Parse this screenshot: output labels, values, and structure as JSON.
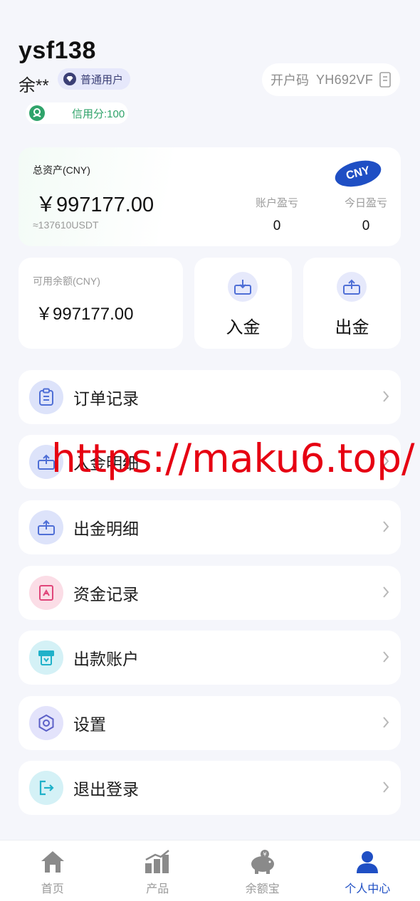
{
  "profile": {
    "username": "ysf138",
    "real_name": "余**",
    "user_level": "普通用户",
    "credit_score": "信用分:100",
    "invite_label": "开户码",
    "invite_code": "YH692VF"
  },
  "assets": {
    "total_label": "总资产(CNY)",
    "total_amount": "￥997177.00",
    "usdt_equiv": "≈137610USDT",
    "currency_badge": "CNY",
    "account_pnl_label": "账户盈亏",
    "account_pnl_value": "0",
    "today_pnl_label": "今日盈亏",
    "today_pnl_value": "0"
  },
  "balance": {
    "available_label": "可用余额(CNY)",
    "available_amount": "￥997177.00",
    "deposit_label": "入金",
    "withdraw_label": "出金"
  },
  "menu": [
    {
      "label": "订单记录",
      "icon": "clipboard-icon",
      "color": "#4f6fd6"
    },
    {
      "label": "入金明细",
      "icon": "deposit-icon",
      "color": "#4f6fd6"
    },
    {
      "label": "出金明细",
      "icon": "withdraw-icon",
      "color": "#4f6fd6"
    },
    {
      "label": "资金记录",
      "icon": "funds-icon",
      "color": "#e0467a"
    },
    {
      "label": "出款账户",
      "icon": "atm-icon",
      "color": "#1fb1c9"
    },
    {
      "label": "设置",
      "icon": "settings-icon",
      "color": "#5b5fc7"
    },
    {
      "label": "退出登录",
      "icon": "logout-icon",
      "color": "#1fb1c9"
    }
  ],
  "watermark": "https://maku6.top/",
  "tabbar": [
    {
      "label": "首页",
      "icon": "home-icon"
    },
    {
      "label": "产品",
      "icon": "chart-icon"
    },
    {
      "label": "余额宝",
      "icon": "piggy-bank-icon"
    },
    {
      "label": "个人中心",
      "icon": "person-icon",
      "active": true
    }
  ],
  "colors": {
    "accent": "#1f4fc4",
    "background": "#f5f6fb",
    "credit_green": "#2fa36a",
    "watermark_red": "#e60012"
  }
}
